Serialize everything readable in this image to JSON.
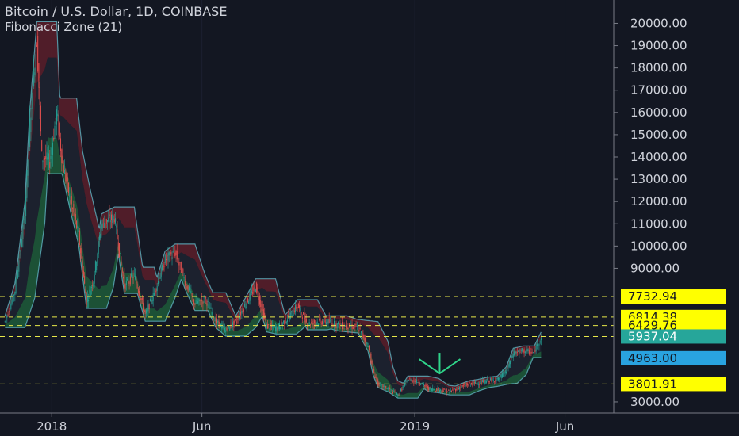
{
  "header": {
    "title": "Bitcoin / U.S. Dollar, 1D, COINBASE",
    "indicator": "Fibonacci Zone (21)"
  },
  "colors": {
    "background": "#131722",
    "text": "#d1d4dc",
    "grid": "#1c2030",
    "dashed_line": "#e8e84a",
    "label_yellow": "#ffff00",
    "label_teal": "#26a69a",
    "label_blue": "#29a3e0",
    "arrow": "#2fd48a",
    "candle_up": "#26a69a",
    "candle_down": "#ef5350",
    "zone_green": "#1f5c3a",
    "zone_red": "#5c1f2a",
    "zone_line": "#5fb3c2"
  },
  "chart_data": {
    "type": "candlestick",
    "instrument": "Bitcoin / U.S. Dollar",
    "timeframe": "1D",
    "exchange": "COINBASE",
    "indicator": "Fibonacci Zone (21)",
    "y_axis": {
      "ticks": [
        3000,
        4000,
        5000,
        6000,
        7000,
        8000,
        9000,
        10000,
        11000,
        12000,
        13000,
        14000,
        15000,
        16000,
        17000,
        18000,
        19000,
        20000
      ],
      "tick_labels": [
        "3000.00",
        "9000.00",
        "10000.00",
        "11000.00",
        "12000.00",
        "13000.00",
        "14000.00",
        "15000.00",
        "16000.00",
        "17000.00",
        "18000.00",
        "19000.00",
        "20000.00"
      ],
      "label_values": [
        3000,
        9000,
        10000,
        11000,
        12000,
        13000,
        14000,
        15000,
        16000,
        17000,
        18000,
        19000,
        20000
      ],
      "range": [
        2500,
        20800
      ]
    },
    "x_axis": {
      "ticks": [
        "2018",
        "Jun",
        "2019",
        "Jun"
      ],
      "tick_dates": [
        "2018-01-01",
        "2018-06-01",
        "2019-01-01",
        "2019-06-01"
      ],
      "range": [
        "2017-11-10",
        "2019-07-20"
      ]
    },
    "horizontal_levels": [
      {
        "label": "7732.94",
        "value": 7732.94,
        "style": "yellow"
      },
      {
        "label": "6814.38",
        "value": 6814.38,
        "style": "yellow"
      },
      {
        "label": "6429.76",
        "value": 6429.76,
        "style": "yellow"
      },
      {
        "label": "5937.04",
        "value": 5937.04,
        "style": "teal"
      },
      {
        "label": "4963.00",
        "value": 4963.0,
        "style": "blue"
      },
      {
        "label": "3801.91",
        "value": 3801.91,
        "style": "yellow"
      }
    ],
    "dashed_lines": [
      7732.94,
      6814.38,
      6429.76,
      5937.04,
      3801.91
    ],
    "price_path": {
      "dates": [
        "2017-11-15",
        "2017-11-25",
        "2017-12-05",
        "2017-12-10",
        "2017-12-17",
        "2017-12-22",
        "2017-12-30",
        "2018-01-06",
        "2018-01-12",
        "2018-01-20",
        "2018-01-28",
        "2018-02-05",
        "2018-02-12",
        "2018-02-20",
        "2018-03-05",
        "2018-03-15",
        "2018-03-25",
        "2018-04-05",
        "2018-04-15",
        "2018-04-25",
        "2018-05-05",
        "2018-05-15",
        "2018-05-25",
        "2018-06-05",
        "2018-06-15",
        "2018-06-25",
        "2018-07-05",
        "2018-07-15",
        "2018-07-25",
        "2018-08-05",
        "2018-08-15",
        "2018-08-25",
        "2018-09-05",
        "2018-09-15",
        "2018-09-25",
        "2018-10-05",
        "2018-10-15",
        "2018-10-25",
        "2018-11-05",
        "2018-11-15",
        "2018-11-20",
        "2018-11-25",
        "2018-12-05",
        "2018-12-15",
        "2018-12-25",
        "2019-01-05",
        "2019-01-15",
        "2019-01-25",
        "2019-02-05",
        "2019-02-15",
        "2019-02-25",
        "2019-03-05",
        "2019-03-15",
        "2019-03-25",
        "2019-04-03",
        "2019-04-10",
        "2019-04-20",
        "2019-04-30",
        "2019-05-08"
      ],
      "close": [
        6600,
        8000,
        11500,
        15500,
        19300,
        14000,
        13800,
        16000,
        13700,
        12000,
        10500,
        7500,
        8500,
        11000,
        11300,
        8200,
        8700,
        6900,
        8000,
        9400,
        9700,
        8400,
        7400,
        7600,
        6600,
        6200,
        6600,
        7400,
        8200,
        6400,
        6300,
        6700,
        7300,
        6500,
        6600,
        6600,
        6450,
        6400,
        6350,
        5500,
        4400,
        3800,
        3600,
        3300,
        4000,
        3900,
        3600,
        3550,
        3450,
        3650,
        3800,
        3850,
        3950,
        4000,
        4400,
        5200,
        5300,
        5200,
        5900
      ]
    },
    "annotations": [
      {
        "type": "arrow-down",
        "date": "2019-01-26",
        "value": 4350,
        "color": "green"
      }
    ]
  }
}
